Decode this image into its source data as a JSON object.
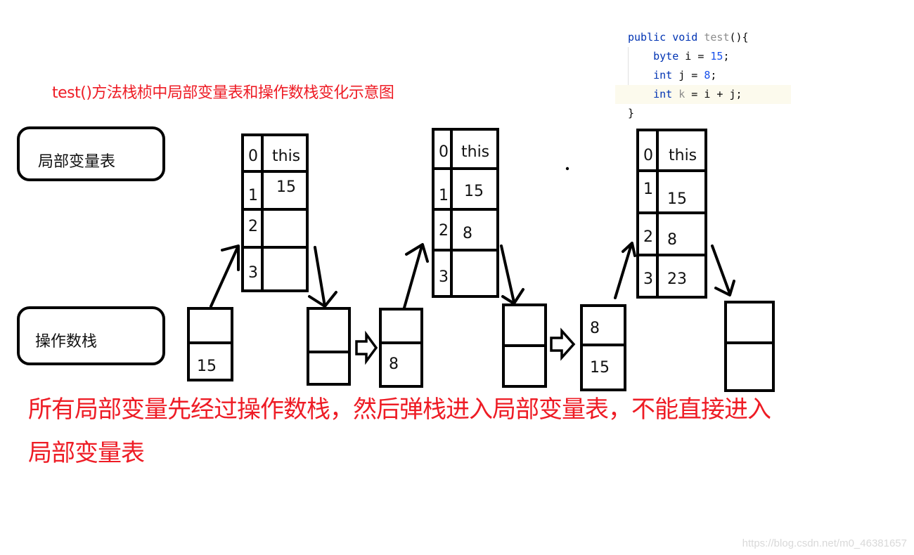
{
  "title": "test()方法栈桢中局部变量表和操作数栈变化示意图",
  "code": {
    "lines": [
      {
        "tokens": [
          {
            "t": "public void ",
            "c": "kw"
          },
          {
            "t": "test",
            "c": "dim"
          },
          {
            "t": "(){",
            "c": "plain"
          }
        ],
        "highlight": false
      },
      {
        "tokens": [
          {
            "t": "    byte ",
            "c": "kw"
          },
          {
            "t": "i = ",
            "c": "plain"
          },
          {
            "t": "15",
            "c": "num"
          },
          {
            "t": ";",
            "c": "plain"
          }
        ],
        "highlight": false
      },
      {
        "tokens": [
          {
            "t": "    int ",
            "c": "kw"
          },
          {
            "t": "j = ",
            "c": "plain"
          },
          {
            "t": "8",
            "c": "num"
          },
          {
            "t": ";",
            "c": "plain"
          }
        ],
        "highlight": false
      },
      {
        "tokens": [
          {
            "t": "    int ",
            "c": "kw"
          },
          {
            "t": "k",
            "c": "dim"
          },
          {
            "t": " = i + j;",
            "c": "plain"
          }
        ],
        "highlight": true
      },
      {
        "tokens": [
          {
            "t": "}",
            "c": "plain"
          }
        ],
        "highlight": false
      }
    ]
  },
  "labels": {
    "local_variable_table": "局部变量表",
    "operand_stack": "操作数栈"
  },
  "local_variable_tables": [
    {
      "slots": [
        {
          "index": "0",
          "value": "this"
        },
        {
          "index": "1",
          "value": "15"
        },
        {
          "index": "2",
          "value": ""
        },
        {
          "index": "3",
          "value": ""
        }
      ]
    },
    {
      "slots": [
        {
          "index": "0",
          "value": "this"
        },
        {
          "index": "1",
          "value": "15"
        },
        {
          "index": "2",
          "value": "8"
        },
        {
          "index": "3",
          "value": ""
        }
      ]
    },
    {
      "slots": [
        {
          "index": "0",
          "value": "this"
        },
        {
          "index": "1",
          "value": "15"
        },
        {
          "index": "2",
          "value": "8"
        },
        {
          "index": "3",
          "value": "23"
        }
      ]
    }
  ],
  "operand_stacks": [
    {
      "top": "",
      "bottom": "15"
    },
    {
      "top": "",
      "bottom": ""
    },
    {
      "top": "",
      "bottom": "8"
    },
    {
      "top": "",
      "bottom": ""
    },
    {
      "top": "8",
      "bottom": "15"
    },
    {
      "top": "",
      "bottom": ""
    }
  ],
  "note": {
    "line1": "所有局部变量先经过操作数栈，然后弹栈进入局部变量表，不能直接进入",
    "line2": "局部变量表"
  },
  "watermark": "https://blog.csdn.net/m0_46381657"
}
